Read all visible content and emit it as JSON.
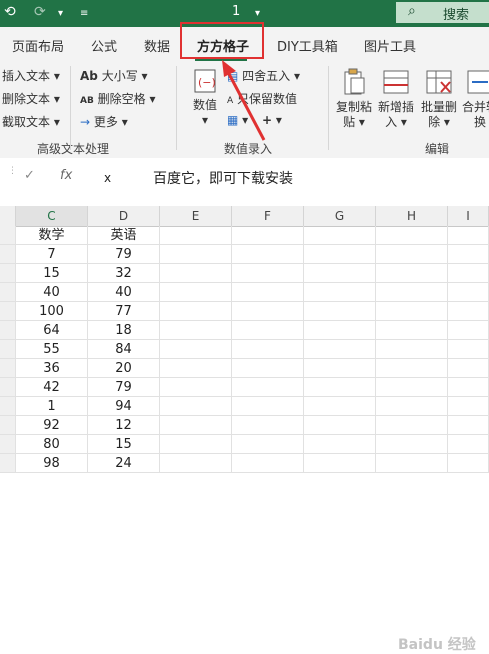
{
  "titlebar": {
    "doc_title": "1",
    "search_label": "搜索"
  },
  "tabs": [
    "页面布局",
    "公式",
    "数据",
    "方方格子",
    "DIY工具箱",
    "图片工具"
  ],
  "ribbon": {
    "group1": {
      "items": [
        "插入文本",
        "删除文本",
        "截取文本"
      ],
      "label": "高级文本处理"
    },
    "group2": {
      "items": [
        "大小写",
        "删除空格",
        "更多"
      ],
      "big_button": "数值"
    },
    "group3": {
      "items": [
        "四舍五入",
        "只保留数值"
      ],
      "label": "数值录入"
    },
    "group4": {
      "buttons": [
        {
          "line1": "复制粘",
          "line2": "贴"
        },
        {
          "line1": "新增插",
          "line2": "入"
        },
        {
          "line1": "批量删",
          "line2": "除"
        },
        {
          "line1": "合并转",
          "line2": "换"
        }
      ],
      "label": "编辑"
    }
  },
  "formula_bar": {
    "fx_label": "fx",
    "value": "x",
    "annotation": "百度它，即可下载安装"
  },
  "grid": {
    "columns": [
      "C",
      "D",
      "E",
      "F",
      "G",
      "H",
      "I"
    ],
    "headers": [
      "数学",
      "英语"
    ],
    "rows": [
      [
        "7",
        "79"
      ],
      [
        "15",
        "32"
      ],
      [
        "40",
        "40"
      ],
      [
        "100",
        "77"
      ],
      [
        "64",
        "18"
      ],
      [
        "55",
        "84"
      ],
      [
        "36",
        "20"
      ],
      [
        "42",
        "79"
      ],
      [
        "1",
        "94"
      ],
      [
        "92",
        "12"
      ],
      [
        "80",
        "15"
      ],
      [
        "98",
        "24"
      ]
    ]
  },
  "colors": {
    "titlebar": "#217346",
    "highlight": "#e03131",
    "ribbon_bg": "#f3f3f3"
  }
}
